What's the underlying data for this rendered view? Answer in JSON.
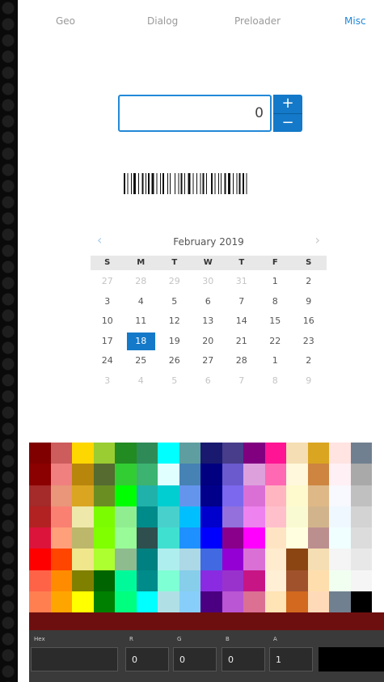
{
  "tabs": [
    {
      "label": "Geo"
    },
    {
      "label": "Dialog"
    },
    {
      "label": "Preloader"
    },
    {
      "label": "Misc",
      "active": true
    }
  ],
  "stepper": {
    "value": "0",
    "increment_label": "+",
    "decrement_label": "−"
  },
  "calendar": {
    "title": "February 2019",
    "prev_icon": "‹",
    "next_icon": "›",
    "weekdays": [
      "S",
      "M",
      "T",
      "W",
      "T",
      "F",
      "S"
    ],
    "days": [
      "27",
      "28",
      "29",
      "30",
      "31",
      "1",
      "2",
      "3",
      "4",
      "5",
      "6",
      "7",
      "8",
      "9",
      "10",
      "11",
      "12",
      "13",
      "14",
      "15",
      "16",
      "17",
      "18",
      "19",
      "20",
      "21",
      "22",
      "23",
      "24",
      "25",
      "26",
      "27",
      "28",
      "1",
      "2",
      "3",
      "4",
      "5",
      "6",
      "7",
      "8",
      "9"
    ],
    "dim_indices": [
      0,
      1,
      2,
      3,
      4,
      35,
      36,
      37,
      38,
      39,
      40,
      41
    ],
    "selected_index": 22
  },
  "palette": {
    "rows": [
      [
        "#800000",
        "#cd5c5c",
        "#ffd700",
        "#9acd32",
        "#228b22",
        "#2e8b57",
        "#00ffff",
        "#5f9ea0",
        "#191970",
        "#483d8b",
        "#800080",
        "#ff1493",
        "#f5deb3",
        "#daa520",
        "#ffe4e1",
        "#708090"
      ],
      [
        "#8b0000",
        "#f08080",
        "#b8860b",
        "#556b2f",
        "#32cd32",
        "#3cb371",
        "#e0ffff",
        "#4682b4",
        "#000080",
        "#6a5acd",
        "#dda0dd",
        "#ff69b4",
        "#fff8dc",
        "#cd853f",
        "#fff0f5",
        "#a9a9a9"
      ],
      [
        "#a52a2a",
        "#e9967a",
        "#daa520",
        "#6b8e23",
        "#00ff00",
        "#20b2aa",
        "#00ced1",
        "#6495ed",
        "#00008b",
        "#7b68ee",
        "#da70d6",
        "#ffb6c1",
        "#fffacd",
        "#deb887",
        "#f8f8ff",
        "#c0c0c0"
      ],
      [
        "#b22222",
        "#fa8072",
        "#eee8aa",
        "#7cfc00",
        "#90ee90",
        "#008b8b",
        "#48d1cc",
        "#00bfff",
        "#0000cd",
        "#9370db",
        "#ee82ee",
        "#ffc0cb",
        "#fafad2",
        "#d2b48c",
        "#f0f8ff",
        "#d3d3d3"
      ],
      [
        "#dc143c",
        "#ffa07a",
        "#bdb76b",
        "#7fff00",
        "#98fb98",
        "#2f4f4f",
        "#40e0d0",
        "#1e90ff",
        "#0000ff",
        "#8b008b",
        "#ff00ff",
        "#ffe4c4",
        "#ffffe0",
        "#bc8f8f",
        "#f0ffff",
        "#dcdcdc"
      ],
      [
        "#ff0000",
        "#ff4500",
        "#f0e68c",
        "#adff2f",
        "#8fbc8f",
        "#008080",
        "#afeeee",
        "#add8e6",
        "#4169e1",
        "#9400d3",
        "#da70d6",
        "#ffebcd",
        "#8b4513",
        "#f5deb3",
        "#f5f5f5",
        "#e8e8e8"
      ],
      [
        "#ff6347",
        "#ff8c00",
        "#808000",
        "#006400",
        "#00fa9a",
        "#008b8b",
        "#7fffd4",
        "#87ceeb",
        "#8a2be2",
        "#9932cc",
        "#c71585",
        "#ffefd5",
        "#a0522d",
        "#ffdead",
        "#f0fff0",
        "#f5f5f5"
      ],
      [
        "#ff7f50",
        "#ffa500",
        "#ffff00",
        "#008000",
        "#00ff7f",
        "#00ffff",
        "#b0e0e6",
        "#87cefa",
        "#4b0082",
        "#ba55d3",
        "#db7093",
        "#ffe4b5",
        "#d2691e",
        "#ffdab9",
        "#708090",
        "#000000"
      ]
    ],
    "last_row_extra": "#ffffff"
  },
  "picker": {
    "strip_color": "#6e0f0f",
    "labels": {
      "hex": "Hex",
      "r": "R",
      "g": "G",
      "b": "B",
      "a": "A"
    },
    "values": {
      "hex": "",
      "r": "0",
      "g": "0",
      "b": "0",
      "a": "1"
    },
    "preview_color": "#000000"
  }
}
